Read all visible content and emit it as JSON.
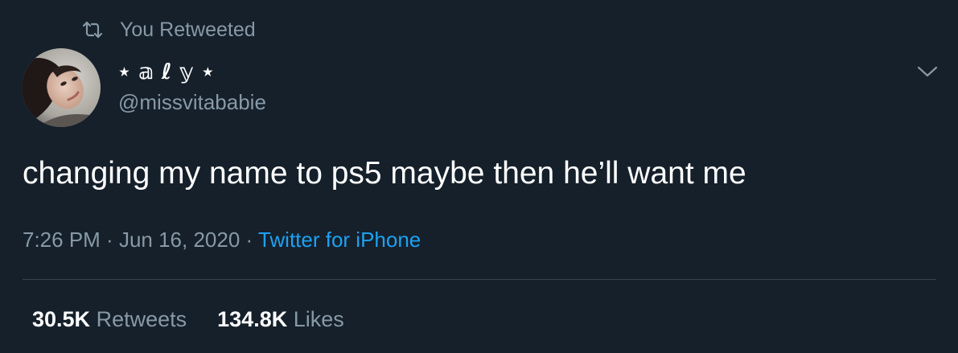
{
  "retweet": {
    "icon": "retweet-icon",
    "label": "You Retweeted"
  },
  "author": {
    "display_name": "⋆ 𝕒 ℓ 𝕪 ⋆",
    "handle": "@missvitababie",
    "avatar_icon": "avatar-photo"
  },
  "menu": {
    "icon": "chevron-down-icon"
  },
  "tweet": {
    "text": "changing my name to ps5 maybe then he’ll want me",
    "time": "7:26 PM",
    "separator_1": " · ",
    "date": "Jun 16, 2020",
    "separator_2": " · ",
    "source": "Twitter for iPhone"
  },
  "stats": {
    "retweets_count": "30.5K",
    "retweets_label": "Retweets",
    "likes_count": "134.8K",
    "likes_label": "Likes"
  },
  "colors": {
    "background": "#15202b",
    "secondary_text": "#8899a6",
    "link": "#1da1f2",
    "divider": "#38444d"
  }
}
